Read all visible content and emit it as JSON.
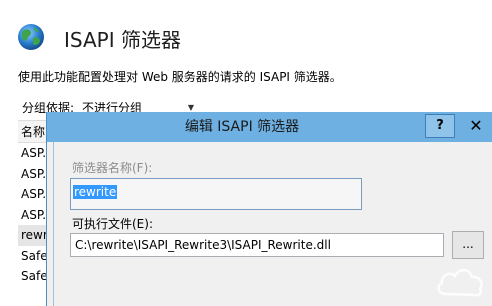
{
  "header": {
    "title": "ISAPI 筛选器",
    "description": "使用此功能配置处理对 Web 服务器的请求的 ISAPI 筛选器。",
    "icon": "globe-icon"
  },
  "groupby": {
    "label": "分组依据:",
    "value": "不进行分组"
  },
  "list": {
    "header": "名称",
    "rows": [
      "ASP.",
      "ASP.",
      "ASP.",
      "ASP.",
      "rewr",
      "Safe",
      "Safe"
    ]
  },
  "dialog": {
    "title": "编辑 ISAPI 筛选器",
    "help_label": "?",
    "close_label": "✕",
    "filter_name_label": "筛选器名称(F):",
    "filter_name_value": "rewrite",
    "exe_label": "可执行文件(E):",
    "exe_value": "C:\\rewrite\\ISAPI_Rewrite3\\ISAPI_Rewrite.dll",
    "browse_label": "..."
  },
  "colors": {
    "titlebar": "#6fb0e3",
    "selection": "#3399ff"
  }
}
